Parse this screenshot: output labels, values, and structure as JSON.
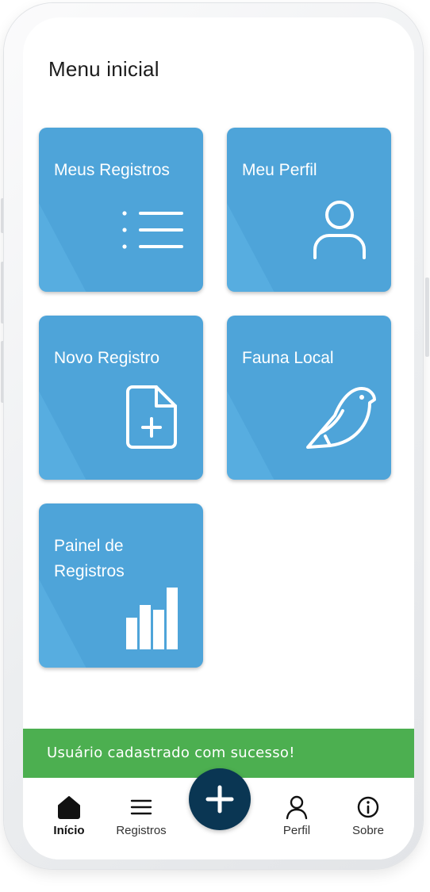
{
  "header": {
    "title": "Menu inicial"
  },
  "tiles": [
    {
      "label": "Meus Registros",
      "icon": "list-icon"
    },
    {
      "label": "Meu Perfil",
      "icon": "user-icon"
    },
    {
      "label": "Novo Registro",
      "icon": "file-plus-icon"
    },
    {
      "label": "Fauna Local",
      "icon": "bird-icon"
    },
    {
      "label": "Painel de Registros",
      "icon": "bar-chart-icon"
    }
  ],
  "toast": {
    "message": "Usuário cadastrado com sucesso!"
  },
  "nav": {
    "items": [
      {
        "label": "Início",
        "icon": "home-icon",
        "active": true
      },
      {
        "label": "Registros",
        "icon": "menu-icon",
        "active": false
      },
      {
        "label": "Perfil",
        "icon": "user-icon",
        "active": false
      },
      {
        "label": "Sobre",
        "icon": "info-icon",
        "active": false
      }
    ],
    "fab_icon": "plus-icon"
  },
  "colors": {
    "tile": "#57ade0",
    "toast": "#4caf50",
    "fab": "#0a3653",
    "text": "#1c1c1c"
  }
}
